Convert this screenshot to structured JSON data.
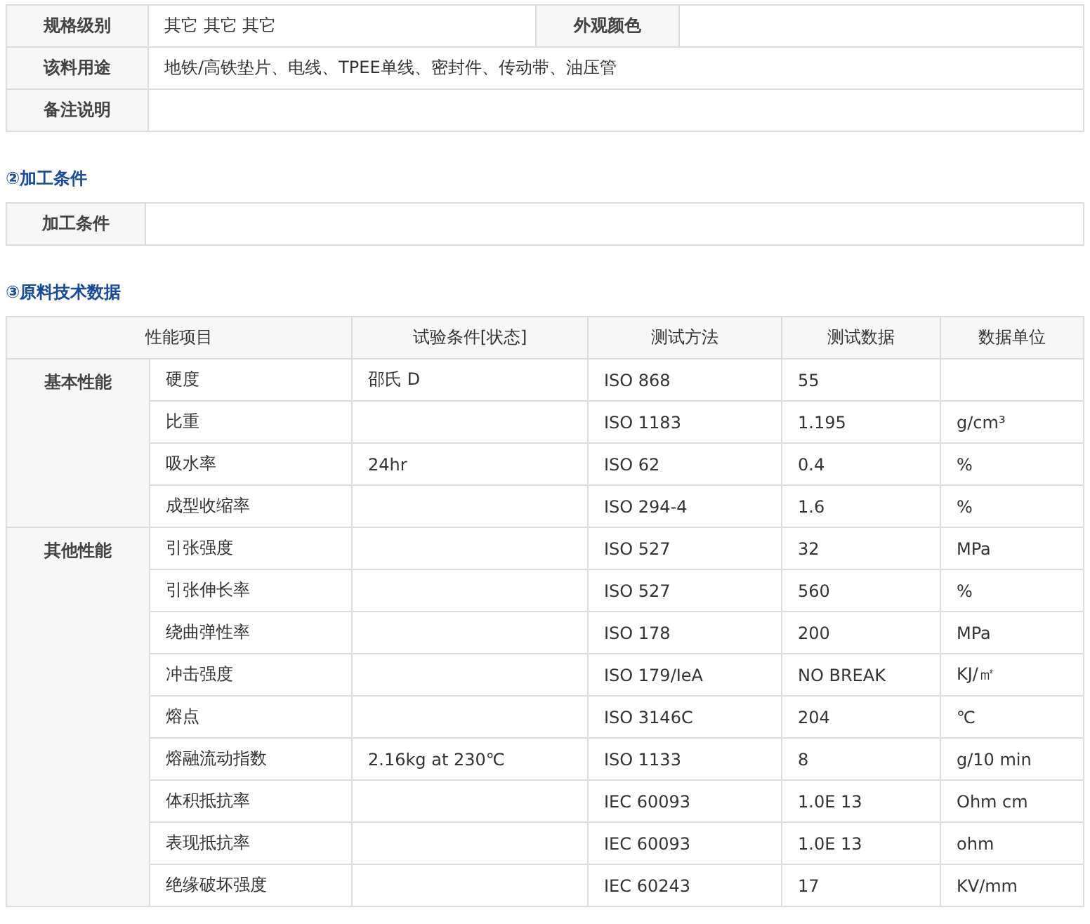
{
  "spec_table": {
    "rows": [
      {
        "label": "规格级别",
        "value": "其它 其它 其它",
        "label_2": "外观颜色",
        "value_2": ""
      },
      {
        "label": "该料用途",
        "value": "地铁/高铁垫片、电线、TPEE单线、密封件、传动带、油压管"
      },
      {
        "label": "备注说明",
        "value": ""
      }
    ]
  },
  "processing": {
    "heading": "②加工条件",
    "rows": [
      {
        "label": "加工条件",
        "value": ""
      }
    ]
  },
  "technical_data": {
    "heading": "③原料技术数据",
    "columns": [
      "性能项目",
      "试验条件[状态]",
      "测试方法",
      "测试数据",
      "数据单位"
    ],
    "groups": [
      {
        "name": "基本性能",
        "rows": [
          {
            "item": "硬度",
            "condition": "邵氏 D",
            "method": "ISO 868",
            "value": "55",
            "unit": ""
          },
          {
            "item": "比重",
            "condition": "",
            "method": "ISO 1183",
            "value": "1.195",
            "unit": "g/cm³"
          },
          {
            "item": "吸水率",
            "condition": "24hr",
            "method": "ISO 62",
            "value": "0.4",
            "unit": "%"
          },
          {
            "item": "成型收缩率",
            "condition": "",
            "method": "ISO 294-4",
            "value": "1.6",
            "unit": "%"
          }
        ]
      },
      {
        "name": "其他性能",
        "rows": [
          {
            "item": "引张强度",
            "condition": "",
            "method": "ISO 527",
            "value": "32",
            "unit": "MPa"
          },
          {
            "item": "引张伸长率",
            "condition": "",
            "method": "ISO 527",
            "value": "560",
            "unit": "%"
          },
          {
            "item": "绕曲弹性率",
            "condition": "",
            "method": "ISO 178",
            "value": "200",
            "unit": "MPa"
          },
          {
            "item": "冲击强度",
            "condition": "",
            "method": "ISO 179/IeA",
            "value": "NO BREAK",
            "unit": "KJ/㎡"
          },
          {
            "item": "熔点",
            "condition": "",
            "method": "ISO 3146C",
            "value": "204",
            "unit": "℃"
          },
          {
            "item": "熔融流动指数",
            "condition": "2.16kg at 230℃",
            "method": "ISO 1133",
            "value": "8",
            "unit": "g/10 min"
          },
          {
            "item": "体积抵抗率",
            "condition": "",
            "method": "IEC 60093",
            "value": "1.0E 13",
            "unit": "Ohm cm"
          },
          {
            "item": "表现抵抗率",
            "condition": "",
            "method": "IEC 60093",
            "value": "1.0E 13",
            "unit": "ohm"
          },
          {
            "item": "绝缘破坏强度",
            "condition": "",
            "method": "IEC 60243",
            "value": "17",
            "unit": "KV/mm"
          }
        ]
      }
    ]
  }
}
